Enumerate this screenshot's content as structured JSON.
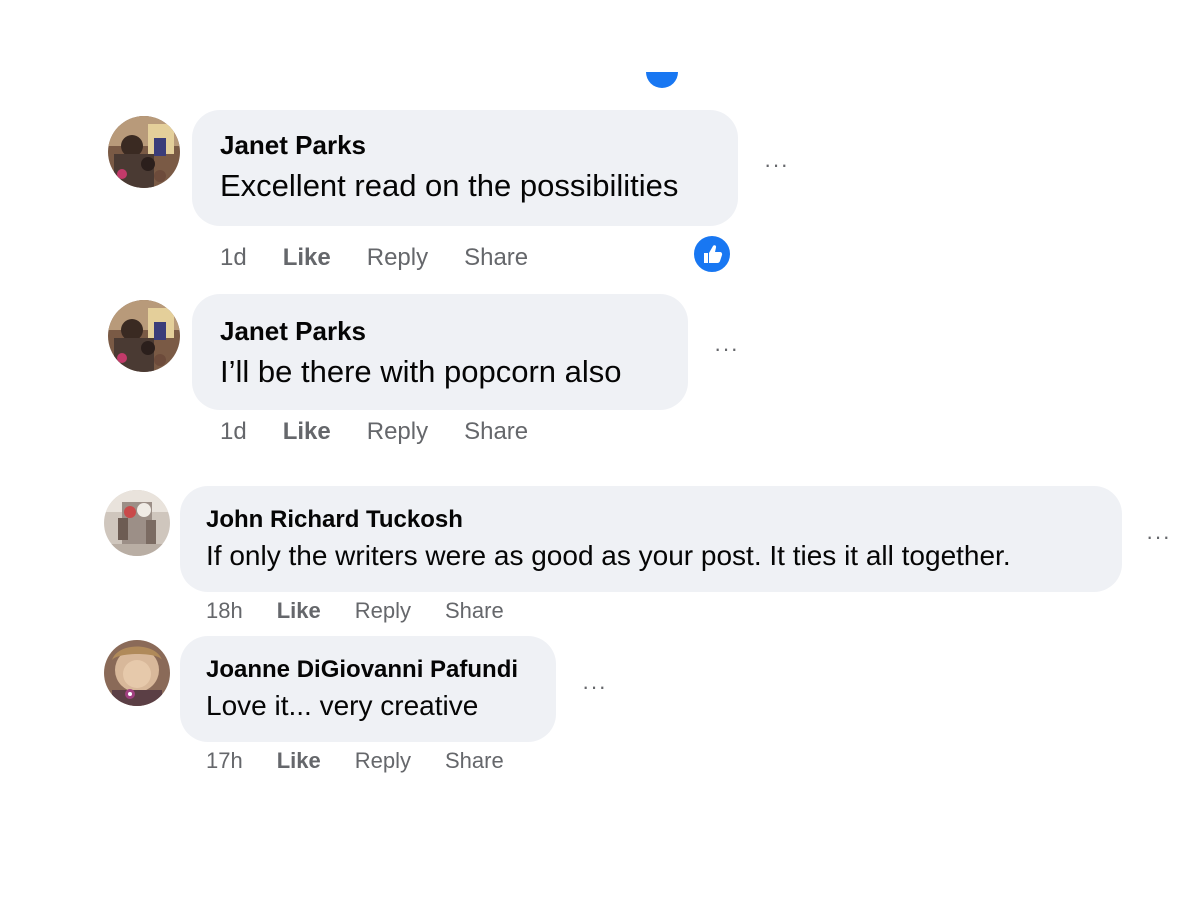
{
  "comments": [
    {
      "author": "Janet Parks",
      "text": "Excellent read on the possibilities",
      "time": "1d",
      "like_label": "Like",
      "reply_label": "Reply",
      "share_label": "Share",
      "more_label": "···",
      "has_like_reaction": true
    },
    {
      "author": "Janet Parks",
      "text": "I’ll be there with popcorn also",
      "time": "1d",
      "like_label": "Like",
      "reply_label": "Reply",
      "share_label": "Share",
      "more_label": "···"
    },
    {
      "author": "John Richard Tuckosh",
      "text": "If only the writers were as good as your post. It ties it all together.",
      "time": "18h",
      "like_label": "Like",
      "reply_label": "Reply",
      "share_label": "Share",
      "more_label": "···"
    },
    {
      "author": "Joanne DiGiovanni Pafundi",
      "text": "Love it... very creative",
      "time": "17h",
      "like_label": "Like",
      "reply_label": "Reply",
      "share_label": "Share",
      "more_label": "···"
    }
  ],
  "icons": {
    "like_reaction": "thumbs-up-icon",
    "more": "more-options-icon"
  },
  "colors": {
    "bubble": "#eff1f5",
    "meta_text": "#65676b",
    "accent_blue": "#1877f2"
  }
}
